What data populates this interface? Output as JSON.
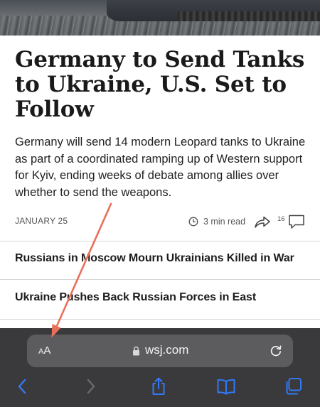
{
  "article": {
    "headline": "Germany to Send Tanks to Ukraine, U.S. Set to Follow",
    "summary": "Germany will send 14 modern Leopard tanks to Ukraine as part of a coordinated ramping up of Western support for Kyiv, ending weeks of debate among allies over whether to send the weapons.",
    "date": "JANUARY 25",
    "read_time": "3 min read",
    "comment_count": "16"
  },
  "related": [
    {
      "title": "Russians in Moscow Mourn Ukrainians Killed in War"
    },
    {
      "title": "Ukraine Pushes Back Russian Forces in East"
    }
  ],
  "browser": {
    "reader_small": "A",
    "reader_big": "A",
    "domain": "wsj.com"
  },
  "icons": {
    "reading_time": "clock-icon",
    "share": "share-arrow-icon",
    "comments": "comment-bubble-icon",
    "secure": "lock-icon",
    "reload": "reload-icon",
    "back": "chevron-left-icon",
    "forward": "chevron-right-icon",
    "share_sheet": "share-box-icon",
    "bookmarks": "book-icon",
    "tabs": "tabs-icon"
  },
  "colors": {
    "accent": "#3478f6",
    "annotation_arrow": "#e8705a",
    "toolbar": "#3a3a3c",
    "urlbar": "#5c5c5f"
  }
}
